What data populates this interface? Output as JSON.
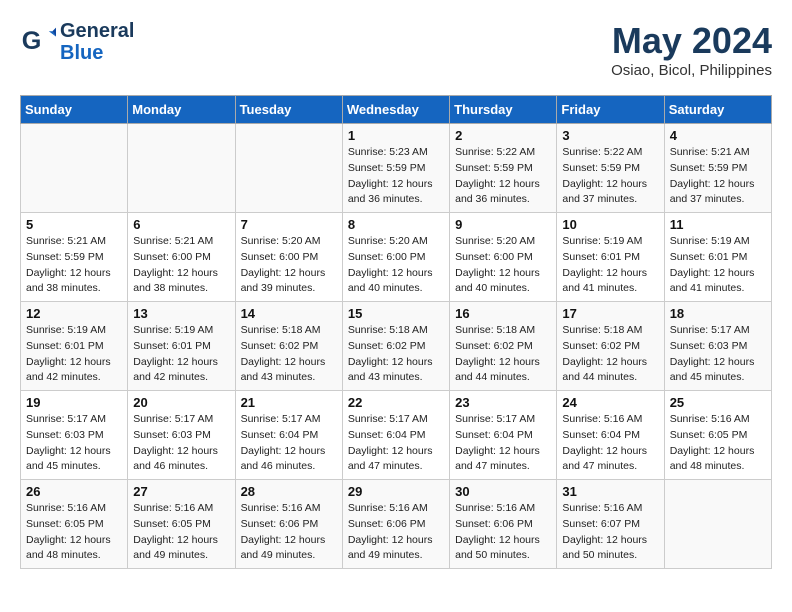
{
  "header": {
    "logo_line1": "General",
    "logo_line2": "Blue",
    "month_title": "May 2024",
    "location": "Osiao, Bicol, Philippines"
  },
  "weekdays": [
    "Sunday",
    "Monday",
    "Tuesday",
    "Wednesday",
    "Thursday",
    "Friday",
    "Saturday"
  ],
  "weeks": [
    [
      {
        "day": "",
        "sunrise": "",
        "sunset": "",
        "daylight": ""
      },
      {
        "day": "",
        "sunrise": "",
        "sunset": "",
        "daylight": ""
      },
      {
        "day": "",
        "sunrise": "",
        "sunset": "",
        "daylight": ""
      },
      {
        "day": "1",
        "sunrise": "Sunrise: 5:23 AM",
        "sunset": "Sunset: 5:59 PM",
        "daylight": "Daylight: 12 hours and 36 minutes."
      },
      {
        "day": "2",
        "sunrise": "Sunrise: 5:22 AM",
        "sunset": "Sunset: 5:59 PM",
        "daylight": "Daylight: 12 hours and 36 minutes."
      },
      {
        "day": "3",
        "sunrise": "Sunrise: 5:22 AM",
        "sunset": "Sunset: 5:59 PM",
        "daylight": "Daylight: 12 hours and 37 minutes."
      },
      {
        "day": "4",
        "sunrise": "Sunrise: 5:21 AM",
        "sunset": "Sunset: 5:59 PM",
        "daylight": "Daylight: 12 hours and 37 minutes."
      }
    ],
    [
      {
        "day": "5",
        "sunrise": "Sunrise: 5:21 AM",
        "sunset": "Sunset: 5:59 PM",
        "daylight": "Daylight: 12 hours and 38 minutes."
      },
      {
        "day": "6",
        "sunrise": "Sunrise: 5:21 AM",
        "sunset": "Sunset: 6:00 PM",
        "daylight": "Daylight: 12 hours and 38 minutes."
      },
      {
        "day": "7",
        "sunrise": "Sunrise: 5:20 AM",
        "sunset": "Sunset: 6:00 PM",
        "daylight": "Daylight: 12 hours and 39 minutes."
      },
      {
        "day": "8",
        "sunrise": "Sunrise: 5:20 AM",
        "sunset": "Sunset: 6:00 PM",
        "daylight": "Daylight: 12 hours and 40 minutes."
      },
      {
        "day": "9",
        "sunrise": "Sunrise: 5:20 AM",
        "sunset": "Sunset: 6:00 PM",
        "daylight": "Daylight: 12 hours and 40 minutes."
      },
      {
        "day": "10",
        "sunrise": "Sunrise: 5:19 AM",
        "sunset": "Sunset: 6:01 PM",
        "daylight": "Daylight: 12 hours and 41 minutes."
      },
      {
        "day": "11",
        "sunrise": "Sunrise: 5:19 AM",
        "sunset": "Sunset: 6:01 PM",
        "daylight": "Daylight: 12 hours and 41 minutes."
      }
    ],
    [
      {
        "day": "12",
        "sunrise": "Sunrise: 5:19 AM",
        "sunset": "Sunset: 6:01 PM",
        "daylight": "Daylight: 12 hours and 42 minutes."
      },
      {
        "day": "13",
        "sunrise": "Sunrise: 5:19 AM",
        "sunset": "Sunset: 6:01 PM",
        "daylight": "Daylight: 12 hours and 42 minutes."
      },
      {
        "day": "14",
        "sunrise": "Sunrise: 5:18 AM",
        "sunset": "Sunset: 6:02 PM",
        "daylight": "Daylight: 12 hours and 43 minutes."
      },
      {
        "day": "15",
        "sunrise": "Sunrise: 5:18 AM",
        "sunset": "Sunset: 6:02 PM",
        "daylight": "Daylight: 12 hours and 43 minutes."
      },
      {
        "day": "16",
        "sunrise": "Sunrise: 5:18 AM",
        "sunset": "Sunset: 6:02 PM",
        "daylight": "Daylight: 12 hours and 44 minutes."
      },
      {
        "day": "17",
        "sunrise": "Sunrise: 5:18 AM",
        "sunset": "Sunset: 6:02 PM",
        "daylight": "Daylight: 12 hours and 44 minutes."
      },
      {
        "day": "18",
        "sunrise": "Sunrise: 5:17 AM",
        "sunset": "Sunset: 6:03 PM",
        "daylight": "Daylight: 12 hours and 45 minutes."
      }
    ],
    [
      {
        "day": "19",
        "sunrise": "Sunrise: 5:17 AM",
        "sunset": "Sunset: 6:03 PM",
        "daylight": "Daylight: 12 hours and 45 minutes."
      },
      {
        "day": "20",
        "sunrise": "Sunrise: 5:17 AM",
        "sunset": "Sunset: 6:03 PM",
        "daylight": "Daylight: 12 hours and 46 minutes."
      },
      {
        "day": "21",
        "sunrise": "Sunrise: 5:17 AM",
        "sunset": "Sunset: 6:04 PM",
        "daylight": "Daylight: 12 hours and 46 minutes."
      },
      {
        "day": "22",
        "sunrise": "Sunrise: 5:17 AM",
        "sunset": "Sunset: 6:04 PM",
        "daylight": "Daylight: 12 hours and 47 minutes."
      },
      {
        "day": "23",
        "sunrise": "Sunrise: 5:17 AM",
        "sunset": "Sunset: 6:04 PM",
        "daylight": "Daylight: 12 hours and 47 minutes."
      },
      {
        "day": "24",
        "sunrise": "Sunrise: 5:16 AM",
        "sunset": "Sunset: 6:04 PM",
        "daylight": "Daylight: 12 hours and 47 minutes."
      },
      {
        "day": "25",
        "sunrise": "Sunrise: 5:16 AM",
        "sunset": "Sunset: 6:05 PM",
        "daylight": "Daylight: 12 hours and 48 minutes."
      }
    ],
    [
      {
        "day": "26",
        "sunrise": "Sunrise: 5:16 AM",
        "sunset": "Sunset: 6:05 PM",
        "daylight": "Daylight: 12 hours and 48 minutes."
      },
      {
        "day": "27",
        "sunrise": "Sunrise: 5:16 AM",
        "sunset": "Sunset: 6:05 PM",
        "daylight": "Daylight: 12 hours and 49 minutes."
      },
      {
        "day": "28",
        "sunrise": "Sunrise: 5:16 AM",
        "sunset": "Sunset: 6:06 PM",
        "daylight": "Daylight: 12 hours and 49 minutes."
      },
      {
        "day": "29",
        "sunrise": "Sunrise: 5:16 AM",
        "sunset": "Sunset: 6:06 PM",
        "daylight": "Daylight: 12 hours and 49 minutes."
      },
      {
        "day": "30",
        "sunrise": "Sunrise: 5:16 AM",
        "sunset": "Sunset: 6:06 PM",
        "daylight": "Daylight: 12 hours and 50 minutes."
      },
      {
        "day": "31",
        "sunrise": "Sunrise: 5:16 AM",
        "sunset": "Sunset: 6:07 PM",
        "daylight": "Daylight: 12 hours and 50 minutes."
      },
      {
        "day": "",
        "sunrise": "",
        "sunset": "",
        "daylight": ""
      }
    ]
  ]
}
